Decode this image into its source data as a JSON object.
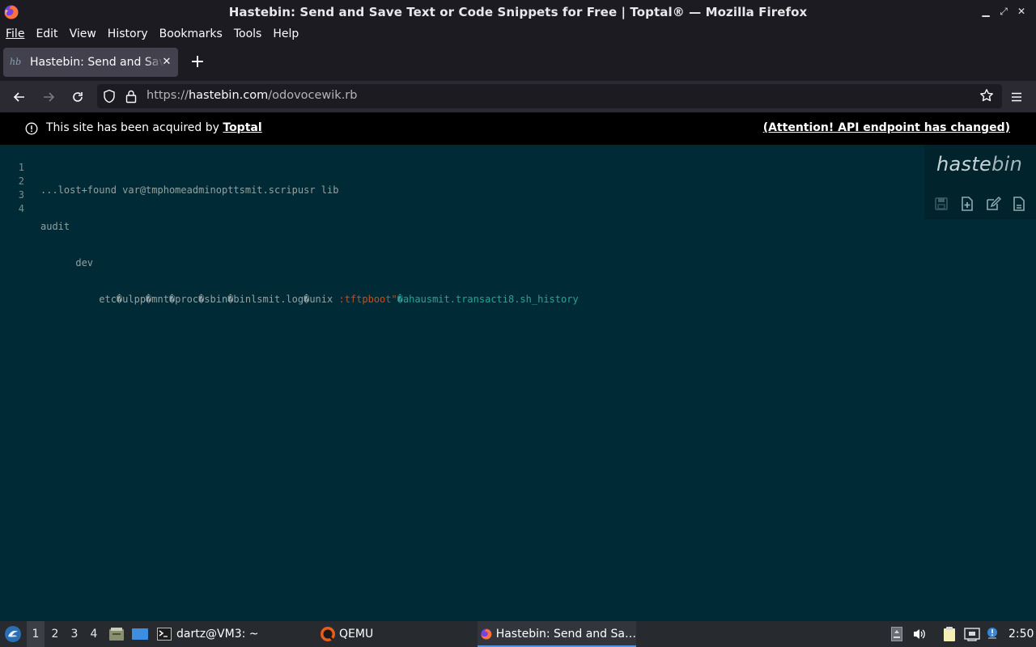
{
  "window": {
    "title": "Hastebin: Send and Save Text or Code Snippets for Free | Toptal® — Mozilla Firefox"
  },
  "menubar": {
    "items": [
      {
        "underline": "F",
        "rest": "ile"
      },
      {
        "underline": "E",
        "rest": "dit"
      },
      {
        "underline": "V",
        "rest": "iew"
      },
      {
        "underline": "Hi",
        "rest": "story",
        "u_first": false
      },
      {
        "underline": "B",
        "rest": "ookmarks"
      },
      {
        "underline": "T",
        "rest": "ools"
      },
      {
        "underline": "H",
        "rest": "elp"
      }
    ],
    "labels": [
      "File",
      "Edit",
      "View",
      "History",
      "Bookmarks",
      "Tools",
      "Help"
    ]
  },
  "tab": {
    "title": "Hastebin: Send and Save Text or Code Snippets for Free | Toptal®",
    "favicon_text": "hb"
  },
  "urlbar": {
    "scheme": "https://",
    "host": "hastebin.com",
    "path": "/odovocewik.rb"
  },
  "notice": {
    "message": "This site has been acquired by ",
    "link": "Toptal",
    "api_notice": "(Attention! API endpoint has changed)"
  },
  "editor": {
    "line_numbers": [
      "1",
      "2",
      "3",
      "4"
    ],
    "lines": [
      "...lost+found var@tmphomeadminopttsmit.scripusr lib",
      "audit",
      "      dev",
      "          etc�ulpp�mnt�proc�sbin�binlsmit.log�unix "
    ],
    "line4_orange": ":tftpboot\"",
    "line4_cyan": "�ahausmit.transacti8.sh_history"
  },
  "logo": {
    "bold": "haste",
    "thin": "bin"
  },
  "taskbar": {
    "workspaces": [
      "1",
      "2",
      "3",
      "4"
    ],
    "active_workspace": "1",
    "terminal_label": "dartz@VM3: ~",
    "qemu_label": "QEMU",
    "firefox_label": "Hastebin: Send and Sa…",
    "clock": "2:50"
  },
  "colors": {
    "editor_bg": "#002b36",
    "accent_blue": "#5294e2",
    "orange_token": "#cb4b16",
    "cyan_token": "#2aa198"
  }
}
